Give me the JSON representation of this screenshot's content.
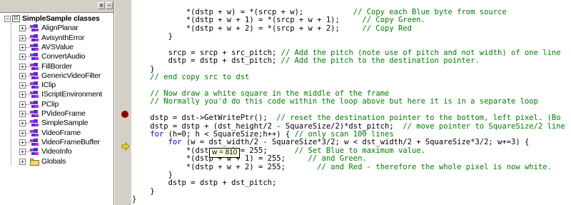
{
  "class_view": {
    "pane_buttons": [
      "×",
      "–"
    ],
    "root": {
      "label": "SimpleSample classes",
      "expander": "−"
    },
    "classes": [
      {
        "label": "AlignPlanar"
      },
      {
        "label": "AvisynthError"
      },
      {
        "label": "AVSValue"
      },
      {
        "label": "ConvertAudio"
      },
      {
        "label": "FillBorder"
      },
      {
        "label": "GenericVideoFilter"
      },
      {
        "label": "IClip"
      },
      {
        "label": "IScriptEnvironment"
      },
      {
        "label": "PClip"
      },
      {
        "label": "PVideoFrame"
      },
      {
        "label": "SimpleSample"
      },
      {
        "label": "VideoFrame"
      },
      {
        "label": "VideoFrameBuffer"
      },
      {
        "label": "VideoInfo"
      }
    ],
    "globals": {
      "label": "Globals"
    },
    "expander_symbol": "+",
    "icon_colors": {
      "blue": "#3a3ad8",
      "magenta": "#d020d0",
      "folder": "#f2d66a"
    }
  },
  "editor": {
    "lines": [
      {
        "code": "            *(dstp + w) = *(srcp + w);",
        "comment": "           // Copy each Blue byte from source"
      },
      {
        "code": "            *(dstp + w + 1) = *(srcp + w + 1);",
        "comment": "     // Copy Green."
      },
      {
        "code": "            *(dstp + w + 2) = *(srcp + w + 2);",
        "comment": "     // Copy Red"
      },
      {
        "code": "        }",
        "comment": ""
      },
      {
        "code": "",
        "comment": ""
      },
      {
        "code": "        srcp = srcp + src_pitch;",
        "comment": " // Add the pitch (note use of pitch and not width) of one line"
      },
      {
        "code": "        dstp = dstp + dst_pitch;",
        "comment": " // Add the pitch to the destination pointer."
      },
      {
        "code": "    }",
        "comment": ""
      },
      {
        "code": "    ",
        "comment": "// end copy src to dst"
      },
      {
        "code": "",
        "comment": ""
      },
      {
        "code": "    ",
        "comment": "// Now draw a white square in the middle of the frame"
      },
      {
        "code": "    ",
        "comment": "// Normally you'd do this code within the loop above but here it is in a separate loop"
      },
      {
        "code": "",
        "comment": ""
      },
      {
        "code": "    dstp = dst->GetWritePtr();",
        "comment": "  // reset the destination pointer to the bottom, left pixel. (Bo"
      },
      {
        "code": "    dstp = dstp + (dst_height/2 - SquareSize/2)*dst_pitch;",
        "comment": "  // move pointer to SquareSize/2 line"
      },
      {
        "code_parts": [
          {
            "t": "    ",
            "k": false
          },
          {
            "t": "for",
            "k": true
          },
          {
            "t": " (h=0; h < SquareSize;h++) { ",
            "k": false
          }
        ],
        "comment": "// only scan 100 lines"
      },
      {
        "code_parts": [
          {
            "t": "        ",
            "k": false
          },
          {
            "t": "for",
            "k": true
          },
          {
            "t": " (w = dst_width/2 - SquareSize*3/2; w < dst_width/2 + SquareSize*3/2; w+=3) {",
            "k": false
          }
        ],
        "comment": ""
      },
      {
        "code": "            *(dstp + w) = 255;",
        "comment": "      // Set Blue to maximum value."
      },
      {
        "code": "            *(dstp + w + 1) = 255;",
        "comment": "     // and Green."
      },
      {
        "code": "            *(dstp + w + 2) = 255;",
        "comment": "       // and Red - therefore the whole pixel is now white."
      },
      {
        "code": "        }",
        "comment": ""
      },
      {
        "code": "        dstp = dstp + dst_pitch;",
        "comment": ""
      },
      {
        "code": "    }",
        "comment": ""
      },
      {
        "code": "}",
        "comment": ""
      }
    ],
    "colors": {
      "comment": "#008000",
      "keyword": "#0000ff",
      "text": "#000000"
    }
  },
  "gutter": {
    "breakpoint_color": "#8b0000",
    "current_line_arrow_color": "#ffd800"
  },
  "tooltip": {
    "text": "w = 810"
  }
}
